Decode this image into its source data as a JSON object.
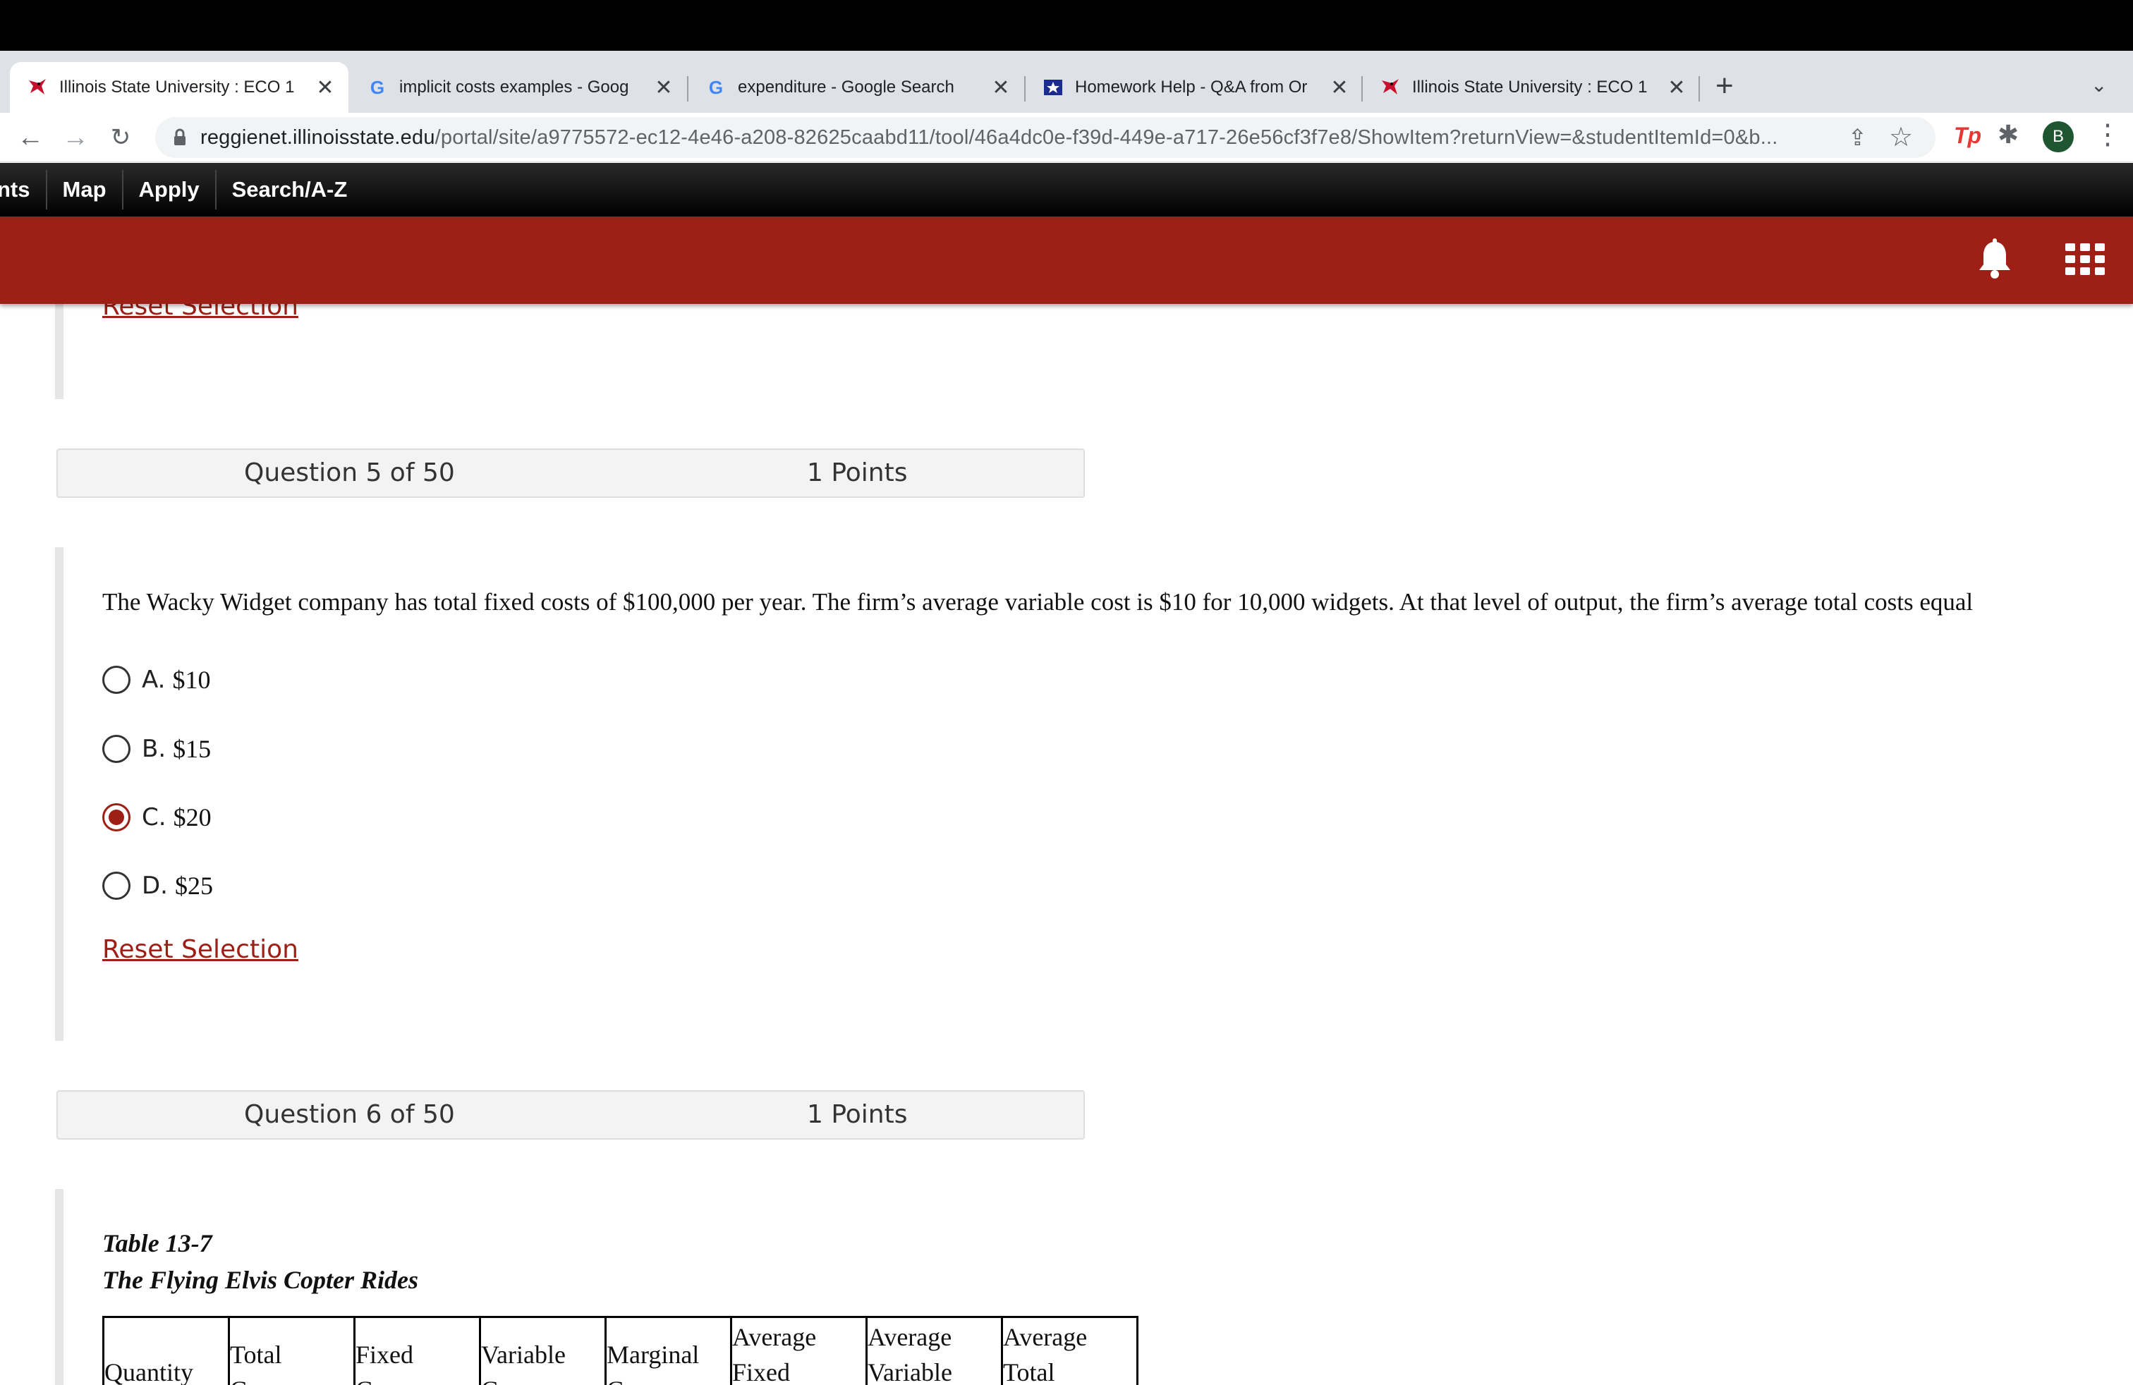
{
  "browser": {
    "tabs": [
      {
        "title": "Illinois State University : ECO 1",
        "favicon": "redbird-icon",
        "active": true
      },
      {
        "title": "implicit costs examples - Goog",
        "favicon": "google-icon",
        "active": false
      },
      {
        "title": "expenditure - Google Search",
        "favicon": "google-icon",
        "active": false
      },
      {
        "title": "Homework Help - Q&A from Or",
        "favicon": "star-shield-icon",
        "active": false
      },
      {
        "title": "Illinois State University : ECO 1",
        "favicon": "redbird-icon",
        "active": false
      }
    ],
    "url_host": "reggienet.illinoisstate.edu",
    "url_path": "/portal/site/a9775572-ec12-4e46-a208-82625caabd11/tool/46a4dc0e-f39d-449e-a717-26e56cf3f7e8/ShowItem?returnView=&studentItemId=0&b...",
    "profile_initial": "B",
    "extension_label": "Tp"
  },
  "site_nav": {
    "items": [
      "nts",
      "Map",
      "Apply",
      "Search/A-Z"
    ]
  },
  "colors": {
    "brand_red": "#9e1f16",
    "nav_black": "#000000"
  },
  "prev_question": {
    "reset_label": "Reset Selection"
  },
  "question5": {
    "number": "Question 5 of 50",
    "points": "1 Points",
    "text": "The Wacky Widget company has total fixed costs of $100,000 per year. The firm’s average variable cost is $10 for 10,000 widgets. At that level of output, the firm’s average total costs equal",
    "options": [
      {
        "letter": "A.",
        "value": "$10",
        "selected": false
      },
      {
        "letter": "B.",
        "value": "$15",
        "selected": false
      },
      {
        "letter": "C.",
        "value": "$20",
        "selected": true
      },
      {
        "letter": "D.",
        "value": "$25",
        "selected": false
      }
    ],
    "reset_label": "Reset Selection"
  },
  "question6": {
    "number": "Question 6 of 50",
    "points": "1 Points",
    "table_label": "Table 13-7",
    "table_title": "The Flying Elvis Copter Rides",
    "columns": [
      [
        "",
        "Quantity"
      ],
      [
        "Total",
        "C"
      ],
      [
        "Fixed",
        "C"
      ],
      [
        "Variable",
        "C"
      ],
      [
        "Marginal",
        "C"
      ],
      [
        "Average",
        "Fixed"
      ],
      [
        "Average",
        "Variable"
      ],
      [
        "Average",
        "Total"
      ]
    ]
  }
}
